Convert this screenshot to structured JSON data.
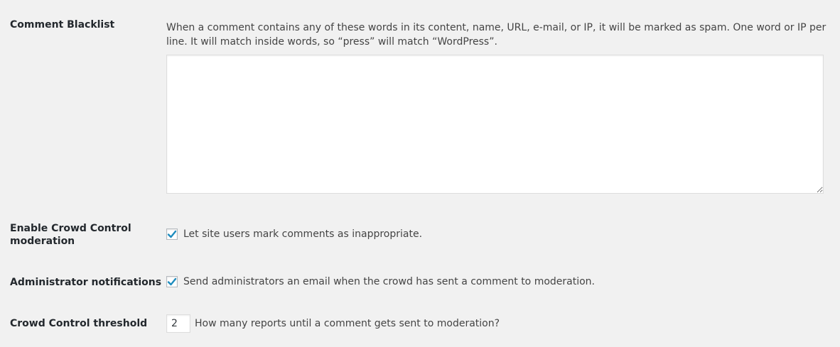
{
  "settings": {
    "blacklist": {
      "label": "Comment Blacklist",
      "description": "When a comment contains any of these words in its content, name, URL, e-mail, or IP, it will be marked as spam. One word or IP per line. It will match inside words, so “press” will match “WordPress”.",
      "value": ""
    },
    "crowd_control": {
      "label_line1": "Enable Crowd Control",
      "label_line2": "moderation",
      "checkbox_label": "Let site users mark comments as inappropriate.",
      "checked": true
    },
    "admin_notifications": {
      "label": "Administrator notifications",
      "checkbox_label": "Send administrators an email when the crowd has sent a comment to moderation.",
      "checked": true
    },
    "threshold": {
      "label": "Crowd Control threshold",
      "value": "2",
      "hint": "How many reports until a comment gets sent to moderation?"
    }
  },
  "colors": {
    "check_blue": "#1e8cbe",
    "background": "#f1f1f1"
  },
  "icons": {
    "checkmark": "checkmark-icon"
  }
}
